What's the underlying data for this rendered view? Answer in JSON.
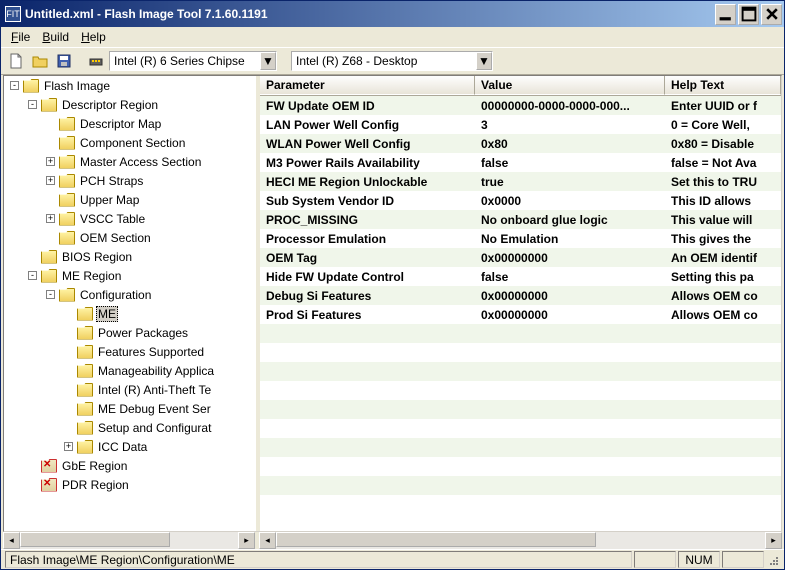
{
  "title": "Untitled.xml - Flash Image Tool 7.1.60.1191",
  "menu": {
    "file": "File",
    "build": "Build",
    "help": "Help"
  },
  "toolbar": {
    "chipset_combo": "Intel (R) 6 Series Chipse",
    "sku_combo": "Intel (R) Z68 - Desktop"
  },
  "tree": [
    {
      "level": 0,
      "expand": "-",
      "icon": "open",
      "label": "Flash Image"
    },
    {
      "level": 1,
      "expand": "-",
      "icon": "open",
      "label": "Descriptor Region"
    },
    {
      "level": 2,
      "expand": "",
      "icon": "closed",
      "label": "Descriptor Map"
    },
    {
      "level": 2,
      "expand": "",
      "icon": "closed",
      "label": "Component Section"
    },
    {
      "level": 2,
      "expand": "+",
      "icon": "closed",
      "label": "Master Access Section"
    },
    {
      "level": 2,
      "expand": "+",
      "icon": "closed",
      "label": "PCH Straps"
    },
    {
      "level": 2,
      "expand": "",
      "icon": "closed",
      "label": "Upper Map"
    },
    {
      "level": 2,
      "expand": "+",
      "icon": "closed",
      "label": "VSCC Table"
    },
    {
      "level": 2,
      "expand": "",
      "icon": "closed",
      "label": "OEM Section"
    },
    {
      "level": 1,
      "expand": "",
      "icon": "closed",
      "label": "BIOS Region"
    },
    {
      "level": 1,
      "expand": "-",
      "icon": "open",
      "label": "ME Region"
    },
    {
      "level": 2,
      "expand": "-",
      "icon": "open",
      "label": "Configuration"
    },
    {
      "level": 3,
      "expand": "",
      "icon": "closed",
      "label": "ME",
      "selected": true
    },
    {
      "level": 3,
      "expand": "",
      "icon": "closed",
      "label": "Power Packages"
    },
    {
      "level": 3,
      "expand": "",
      "icon": "closed",
      "label": "Features Supported"
    },
    {
      "level": 3,
      "expand": "",
      "icon": "closed",
      "label": "Manageability Applica"
    },
    {
      "level": 3,
      "expand": "",
      "icon": "closed",
      "label": "Intel (R) Anti-Theft Te"
    },
    {
      "level": 3,
      "expand": "",
      "icon": "closed",
      "label": "ME Debug Event Ser"
    },
    {
      "level": 3,
      "expand": "",
      "icon": "closed",
      "label": "Setup and Configurat"
    },
    {
      "level": 3,
      "expand": "+",
      "icon": "closed",
      "label": "ICC Data"
    },
    {
      "level": 1,
      "expand": "",
      "icon": "disabled",
      "label": "GbE Region"
    },
    {
      "level": 1,
      "expand": "",
      "icon": "disabled",
      "label": "PDR Region"
    }
  ],
  "table": {
    "headers": {
      "param": "Parameter",
      "value": "Value",
      "help": "Help Text"
    },
    "rows": [
      {
        "param": "FW Update OEM ID",
        "value": "00000000-0000-0000-000...",
        "help": "Enter UUID or f"
      },
      {
        "param": "LAN Power Well Config",
        "value": "3",
        "help": "0 = Core Well, "
      },
      {
        "param": "WLAN Power Well Config",
        "value": "0x80",
        "help": "0x80 = Disable"
      },
      {
        "param": "M3 Power Rails Availability",
        "value": "false",
        "help": "false = Not Ava"
      },
      {
        "param": "HECI ME Region Unlockable",
        "value": "true",
        "help": "Set this to TRU"
      },
      {
        "param": "Sub System Vendor ID",
        "value": "0x0000",
        "help": "This ID allows "
      },
      {
        "param": "PROC_MISSING",
        "value": "No onboard glue logic",
        "help": "This value will "
      },
      {
        "param": "Processor Emulation",
        "value": "No Emulation",
        "help": "This gives the "
      },
      {
        "param": "OEM Tag",
        "value": "0x00000000",
        "help": "An OEM identif"
      },
      {
        "param": "Hide FW Update Control",
        "value": "false",
        "help": "Setting this pa"
      },
      {
        "param": "Debug Si Features",
        "value": "0x00000000",
        "help": "Allows OEM co"
      },
      {
        "param": "Prod Si Features",
        "value": "0x00000000",
        "help": "Allows OEM co"
      }
    ]
  },
  "statusbar": {
    "path": "Flash Image\\ME Region\\Configuration\\ME",
    "num": "NUM"
  }
}
